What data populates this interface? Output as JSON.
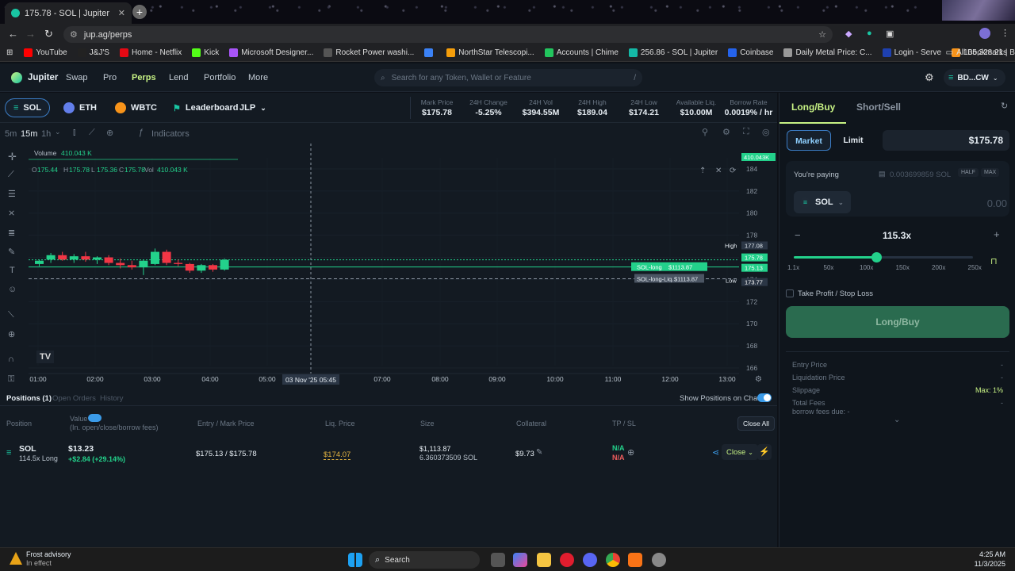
{
  "browser": {
    "tab_title": "175.78 - SOL | Jupiter",
    "url": "jup.ag/perps",
    "bookmarks": [
      {
        "label": "YouTube",
        "color": "#ff0000"
      },
      {
        "label": "J&J'S",
        "color": "#222"
      },
      {
        "label": "Home - Netflix",
        "color": "#e50914"
      },
      {
        "label": "Kick",
        "color": "#53fc18"
      },
      {
        "label": "Microsoft Designer...",
        "color": "#a855f7"
      },
      {
        "label": "Rocket Power washi...",
        "color": "#555"
      },
      {
        "label": "",
        "color": "#3b82f6"
      },
      {
        "label": "NorthStar Telescopi...",
        "color": "#f59e0b"
      },
      {
        "label": "Accounts | Chime",
        "color": "#22c55e"
      },
      {
        "label": "256.86 - SOL | Jupiter",
        "color": "#14b8a6"
      },
      {
        "label": "Coinbase",
        "color": "#2563eb"
      },
      {
        "label": "Daily Metal Price: C...",
        "color": "#999"
      },
      {
        "label": "Login - Serve",
        "color": "#1e40af"
      },
      {
        "label": "105,328.21 | BTC/US...",
        "color": "#f7931a"
      }
    ],
    "all_bookmarks": "All Bookmarks"
  },
  "nav": {
    "brand": "Jupiter",
    "links": [
      "Swap",
      "Pro",
      "Perps",
      "Lend",
      "Portfolio",
      "More"
    ],
    "search_placeholder": "Search for any Token, Wallet or Feature",
    "search_shortcut": "/",
    "wallet": "BD...CW"
  },
  "market": {
    "assets": [
      "SOL",
      "ETH",
      "WBTC"
    ],
    "leaderboard": "Leaderboard",
    "jlp": "JLP",
    "stats": [
      {
        "label": "Mark Price",
        "value": "$175.78"
      },
      {
        "label": "24H Change",
        "value": "-5.25%"
      },
      {
        "label": "24H Vol",
        "value": "$394.55M"
      },
      {
        "label": "24H High",
        "value": "$189.04"
      },
      {
        "label": "24H Low",
        "value": "$174.21"
      },
      {
        "label": "Available Liq.",
        "value": "$10.00M"
      },
      {
        "label": "Borrow Rate",
        "value": "0.0019% / hr"
      }
    ]
  },
  "chart_toolbar": {
    "intervals": [
      "5m",
      "15m",
      "1h"
    ],
    "indicators": "Indicators"
  },
  "chart_data": {
    "type": "candlestick",
    "volume_label": "Volume",
    "volume_value": "410.043 K",
    "ohlc": {
      "o": "175.44",
      "h": "175.78",
      "l": "175.36",
      "c": "175.78",
      "vol": "410.043 K"
    },
    "y_ticks": [
      184,
      182,
      180,
      178,
      176,
      174,
      172,
      170,
      168,
      166
    ],
    "x_ticks": [
      "01:00",
      "02:00",
      "03:00",
      "04:00",
      "05:00",
      "07:00",
      "08:00",
      "09:00",
      "10:00",
      "11:00",
      "12:00",
      "13:00"
    ],
    "crosshair_label": "03 Nov '25   05:45",
    "vol_badge": "410.043K",
    "high_label": "High",
    "high_value": "177.08",
    "low_label": "Low",
    "price_badges": [
      "175.78",
      "175.13",
      "173.77"
    ],
    "lines": [
      {
        "label": "SOL-long",
        "value": "$1113.87",
        "y": 175.13
      },
      {
        "label": "SOL-long-Liq.",
        "value": "$1113.87",
        "y": 174.07
      }
    ],
    "candles": [
      {
        "o": 175.4,
        "h": 175.8,
        "l": 175.2,
        "c": 175.7
      },
      {
        "o": 175.8,
        "h": 176.4,
        "l": 175.5,
        "c": 176.2
      },
      {
        "o": 176.2,
        "h": 176.5,
        "l": 175.7,
        "c": 175.8
      },
      {
        "o": 175.8,
        "h": 176.3,
        "l": 175.5,
        "c": 176.1
      },
      {
        "o": 176.1,
        "h": 176.5,
        "l": 175.6,
        "c": 175.8
      },
      {
        "o": 175.8,
        "h": 176.1,
        "l": 175.4,
        "c": 176.0
      },
      {
        "o": 176.0,
        "h": 176.2,
        "l": 175.3,
        "c": 175.5
      },
      {
        "o": 175.5,
        "h": 175.9,
        "l": 175.0,
        "c": 175.3
      },
      {
        "o": 175.3,
        "h": 175.7,
        "l": 174.9,
        "c": 175.1
      },
      {
        "o": 175.1,
        "h": 175.8,
        "l": 174.4,
        "c": 175.7
      },
      {
        "o": 175.4,
        "h": 176.8,
        "l": 175.3,
        "c": 176.5
      },
      {
        "o": 176.5,
        "h": 176.7,
        "l": 175.3,
        "c": 175.5
      },
      {
        "o": 175.5,
        "h": 175.8,
        "l": 175.2,
        "c": 175.4
      },
      {
        "o": 175.4,
        "h": 175.5,
        "l": 174.6,
        "c": 174.8
      },
      {
        "o": 174.8,
        "h": 175.4,
        "l": 174.6,
        "c": 175.3
      },
      {
        "o": 175.3,
        "h": 175.4,
        "l": 174.7,
        "c": 174.9
      },
      {
        "o": 174.9,
        "h": 175.9,
        "l": 174.8,
        "c": 175.78
      }
    ]
  },
  "positions": {
    "tabs": [
      "Positions (1)",
      "Open Orders",
      "History"
    ],
    "show_on_chart": "Show Positions on Chart",
    "headers": [
      "Position",
      "Value",
      "(In. open/close/borrow fees)",
      "Entry / Mark Price",
      "Liq. Price",
      "Size",
      "Collateral",
      "TP / SL"
    ],
    "close_all": "Close All",
    "row": {
      "asset": "SOL",
      "lev": "114.5x Long",
      "value": "$13.23",
      "pnl": "+$2.84 (+29.14%)",
      "entry_mark": "$175.13 / $175.78",
      "liq": "$174.07",
      "size_usd": "$1,113.87",
      "size_sol": "6.360373509 SOL",
      "collateral": "$9.73",
      "tp": "N/A",
      "sl": "N/A",
      "close": "Close"
    }
  },
  "panel": {
    "tabs": [
      "Long/Buy",
      "Short/Sell"
    ],
    "order_types": [
      "Market",
      "Limit"
    ],
    "price": "$175.78",
    "paying_label": "You're paying",
    "balance": "0.003699859 SOL",
    "half": "HALF",
    "max": "MAX",
    "token": "SOL",
    "amount": "0.00",
    "leverage": "115.3x",
    "lev_fraction": 0.46,
    "lev_marks": [
      "1.1x",
      "50x",
      "100x",
      "150x",
      "200x",
      "250x"
    ],
    "tpsl": "Take Profit / Stop Loss",
    "submit": "Long/Buy",
    "details": [
      {
        "label": "Entry Price",
        "value": "-"
      },
      {
        "label": "Liquidation Price",
        "value": "-"
      },
      {
        "label": "Slippage",
        "value": "Max: 1%"
      },
      {
        "label": "Total Fees",
        "value": "-"
      }
    ],
    "borrow_fees": "borrow fees due: -"
  },
  "taskbar": {
    "weather_title": "Frost advisory",
    "weather_sub": "In effect",
    "search": "Search",
    "time": "4:25 AM",
    "date": "11/3/2025"
  }
}
